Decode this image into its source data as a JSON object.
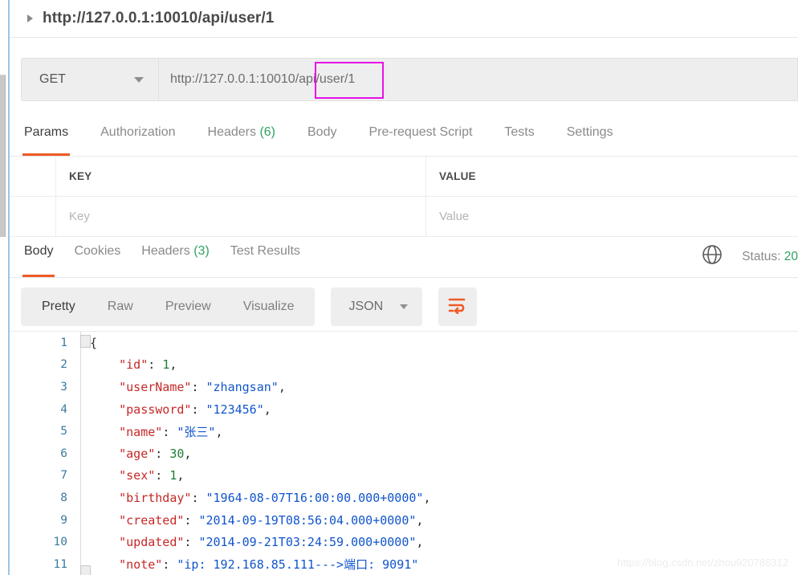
{
  "request": {
    "title": "http://127.0.0.1:10010/api/user/1",
    "method": "GET",
    "url": "http://127.0.0.1:10010/api/user/1",
    "annotation_color": "#e812e8",
    "tabs": [
      {
        "label": "Params",
        "count": "",
        "active": true
      },
      {
        "label": "Authorization",
        "count": "",
        "active": false
      },
      {
        "label": "Headers",
        "count": "(6)",
        "active": false
      },
      {
        "label": "Body",
        "count": "",
        "active": false
      },
      {
        "label": "Pre-request Script",
        "count": "",
        "active": false
      },
      {
        "label": "Tests",
        "count": "",
        "active": false
      },
      {
        "label": "Settings",
        "count": "",
        "active": false
      }
    ]
  },
  "params_table": {
    "headers": {
      "key": "KEY",
      "value": "VALUE"
    },
    "row": {
      "key_placeholder": "Key",
      "value_placeholder": "Value"
    }
  },
  "response": {
    "tabs": [
      {
        "label": "Body",
        "count": "",
        "active": true
      },
      {
        "label": "Cookies",
        "count": "",
        "active": false
      },
      {
        "label": "Headers",
        "count": "(3)",
        "active": false
      },
      {
        "label": "Test Results",
        "count": "",
        "active": false
      }
    ],
    "status_label": "Status:",
    "status_code": "20",
    "views": [
      {
        "label": "Pretty",
        "active": true
      },
      {
        "label": "Raw",
        "active": false
      },
      {
        "label": "Preview",
        "active": false
      },
      {
        "label": "Visualize",
        "active": false
      }
    ],
    "format": "JSON",
    "accent_color": "#ef5b25",
    "success_color": "#2fa360"
  },
  "body_lines": [
    {
      "no": "1",
      "segments": [
        {
          "t": "{",
          "c": "p"
        }
      ]
    },
    {
      "no": "2",
      "segments": [
        {
          "t": "    \"id\"",
          "c": "k"
        },
        {
          "t": ": ",
          "c": "p"
        },
        {
          "t": "1",
          "c": "n"
        },
        {
          "t": ",",
          "c": "p"
        }
      ]
    },
    {
      "no": "3",
      "segments": [
        {
          "t": "    \"userName\"",
          "c": "k"
        },
        {
          "t": ": ",
          "c": "p"
        },
        {
          "t": "\"zhangsan\"",
          "c": "s"
        },
        {
          "t": ",",
          "c": "p"
        }
      ]
    },
    {
      "no": "4",
      "segments": [
        {
          "t": "    \"password\"",
          "c": "k"
        },
        {
          "t": ": ",
          "c": "p"
        },
        {
          "t": "\"123456\"",
          "c": "s"
        },
        {
          "t": ",",
          "c": "p"
        }
      ]
    },
    {
      "no": "5",
      "segments": [
        {
          "t": "    \"name\"",
          "c": "k"
        },
        {
          "t": ": ",
          "c": "p"
        },
        {
          "t": "\"张三\"",
          "c": "s"
        },
        {
          "t": ",",
          "c": "p"
        }
      ]
    },
    {
      "no": "6",
      "segments": [
        {
          "t": "    \"age\"",
          "c": "k"
        },
        {
          "t": ": ",
          "c": "p"
        },
        {
          "t": "30",
          "c": "n"
        },
        {
          "t": ",",
          "c": "p"
        }
      ]
    },
    {
      "no": "7",
      "segments": [
        {
          "t": "    \"sex\"",
          "c": "k"
        },
        {
          "t": ": ",
          "c": "p"
        },
        {
          "t": "1",
          "c": "n"
        },
        {
          "t": ",",
          "c": "p"
        }
      ]
    },
    {
      "no": "8",
      "segments": [
        {
          "t": "    \"birthday\"",
          "c": "k"
        },
        {
          "t": ": ",
          "c": "p"
        },
        {
          "t": "\"1964-08-07T16:00:00.000+0000\"",
          "c": "s"
        },
        {
          "t": ",",
          "c": "p"
        }
      ]
    },
    {
      "no": "9",
      "segments": [
        {
          "t": "    \"created\"",
          "c": "k"
        },
        {
          "t": ": ",
          "c": "p"
        },
        {
          "t": "\"2014-09-19T08:56:04.000+0000\"",
          "c": "s"
        },
        {
          "t": ",",
          "c": "p"
        }
      ]
    },
    {
      "no": "10",
      "segments": [
        {
          "t": "    \"updated\"",
          "c": "k"
        },
        {
          "t": ": ",
          "c": "p"
        },
        {
          "t": "\"2014-09-21T03:24:59.000+0000\"",
          "c": "s"
        },
        {
          "t": ",",
          "c": "p"
        }
      ]
    },
    {
      "no": "11",
      "segments": [
        {
          "t": "    \"note\"",
          "c": "k"
        },
        {
          "t": ": ",
          "c": "p"
        },
        {
          "t": "\"ip: 192.168.85.111--->端口: 9091\"",
          "c": "s"
        }
      ]
    }
  ],
  "watermark": "https://blog.csdn.net/zhou920786312"
}
